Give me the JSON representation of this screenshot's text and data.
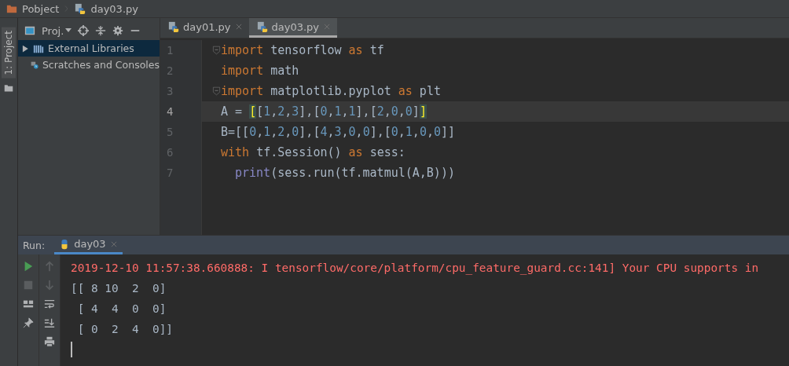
{
  "breadcrumb": [
    {
      "label": "Pobject",
      "kind": "folder"
    },
    {
      "label": "day03.py",
      "kind": "python"
    }
  ],
  "side_tab": {
    "label": "1: Project"
  },
  "project_panel": {
    "view": "Proj.",
    "items": [
      {
        "label": "External Libraries",
        "kind": "libraries",
        "selected": true,
        "expanded": false
      },
      {
        "label": "Scratches and Consoles",
        "kind": "scratches",
        "selected": false
      }
    ]
  },
  "editor_tabs": [
    {
      "label": "day01.py",
      "selected": false
    },
    {
      "label": "day03.py",
      "selected": true
    }
  ],
  "code_lines": [
    {
      "number": "1",
      "current": false,
      "fold": true,
      "indent": false,
      "tokens": [
        {
          "kind": "kw",
          "t": "import"
        },
        {
          "kind": "plain",
          "t": " tensorflow "
        },
        {
          "kind": "kw",
          "t": "as"
        },
        {
          "kind": "plain",
          "t": " tf"
        }
      ]
    },
    {
      "number": "2",
      "current": false,
      "fold": false,
      "indent": false,
      "tokens": [
        {
          "kind": "kw",
          "t": "import"
        },
        {
          "kind": "plain",
          "t": " math"
        }
      ]
    },
    {
      "number": "3",
      "current": false,
      "fold": true,
      "indent": false,
      "tokens": [
        {
          "kind": "kw",
          "t": "import"
        },
        {
          "kind": "plain",
          "t": " matplotlib.pyplot "
        },
        {
          "kind": "kw",
          "t": "as"
        },
        {
          "kind": "plain",
          "t": " plt"
        }
      ]
    },
    {
      "number": "4",
      "current": true,
      "fold": false,
      "indent": false,
      "tokens": [
        {
          "kind": "plain",
          "t": "A = "
        },
        {
          "kind": "match",
          "t": "["
        },
        {
          "kind": "plain",
          "t": "[1,2,3],[0,1,1],[2,0,0]"
        },
        {
          "kind": "match",
          "t": "]"
        }
      ]
    },
    {
      "number": "5",
      "current": false,
      "fold": false,
      "indent": false,
      "tokens": [
        {
          "kind": "plain",
          "t": "B=[[0,1,2,0],[4,3,0,0],[0,1,0,0]]"
        }
      ]
    },
    {
      "number": "6",
      "current": false,
      "fold": false,
      "indent": false,
      "tokens": [
        {
          "kind": "kw",
          "t": "with"
        },
        {
          "kind": "plain",
          "t": " tf.Session() "
        },
        {
          "kind": "kw",
          "t": "as"
        },
        {
          "kind": "plain",
          "t": " sess:"
        }
      ]
    },
    {
      "number": "7",
      "current": false,
      "fold": false,
      "indent": true,
      "tokens": [
        {
          "kind": "builtin",
          "t": "print"
        },
        {
          "kind": "plain",
          "t": "(sess.run(tf.matmul(A,B)))"
        }
      ]
    }
  ],
  "run_panel": {
    "label": "Run:",
    "tab": {
      "label": "day03",
      "selected": true
    },
    "output": [
      {
        "kind": "error",
        "text": "2019-12-10 11:57:38.660888: I tensorflow/core/platform/cpu_feature_guard.cc:141] Your CPU supports in"
      },
      {
        "kind": "out",
        "text": "[[ 8 10  2  0]"
      },
      {
        "kind": "out",
        "text": " [ 4  4  0  0]"
      },
      {
        "kind": "out",
        "text": " [ 0  2  4  0]]"
      }
    ]
  }
}
